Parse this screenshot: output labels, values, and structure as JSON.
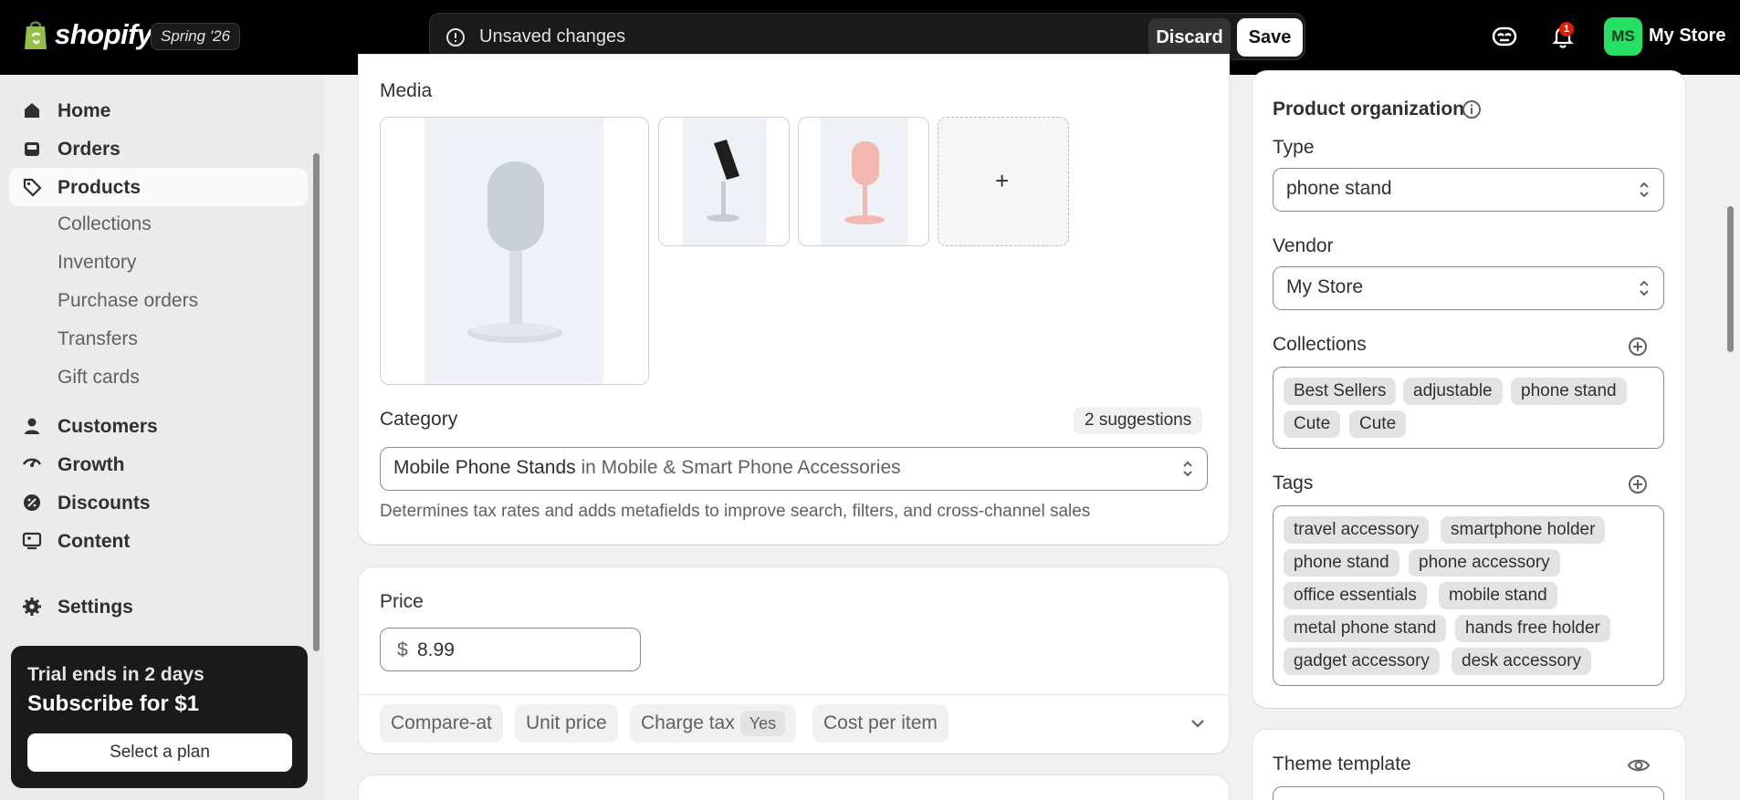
{
  "topbar": {
    "brand": "shopify",
    "edition_badge": "Spring '26",
    "unsaved_text": "Unsaved changes",
    "discard_label": "Discard",
    "save_label": "Save",
    "notification_count": "1",
    "avatar_initials": "MS",
    "store_name": "My Store"
  },
  "sidebar": {
    "items": [
      {
        "label": "Home",
        "icon": "home-icon"
      },
      {
        "label": "Orders",
        "icon": "inbox-icon"
      },
      {
        "label": "Products",
        "icon": "tag-icon"
      },
      {
        "label": "Customers",
        "icon": "person-icon"
      },
      {
        "label": "Growth",
        "icon": "growth-icon"
      },
      {
        "label": "Discounts",
        "icon": "discount-icon"
      },
      {
        "label": "Content",
        "icon": "content-icon"
      },
      {
        "label": "Settings",
        "icon": "gear-icon"
      }
    ],
    "product_subitems": [
      "Collections",
      "Inventory",
      "Purchase orders",
      "Transfers",
      "Gift cards"
    ],
    "trial": {
      "line1": "Trial ends in 2 days",
      "line2": "Subscribe for $1",
      "button": "Select a plan"
    }
  },
  "media": {
    "title": "Media"
  },
  "category": {
    "title": "Category",
    "suggestions": "2 suggestions",
    "value_main": "Mobile Phone Stands",
    "value_rest": " in Mobile & Smart Phone Accessories",
    "help": "Determines tax rates and adds metafields to improve search, filters, and cross-channel sales"
  },
  "price": {
    "title": "Price",
    "currency": "$",
    "value": "8.99",
    "options": {
      "compare_at": "Compare-at",
      "unit_price": "Unit price",
      "charge_tax": "Charge tax",
      "charge_tax_value": "Yes",
      "cost_per_item": "Cost per item"
    }
  },
  "organization": {
    "title": "Product organization",
    "type_label": "Type",
    "type_value": "phone stand",
    "vendor_label": "Vendor",
    "vendor_value": "My Store",
    "collections_label": "Collections",
    "collections": [
      "Best Sellers",
      "adjustable",
      "phone stand",
      "Cute",
      "Cute"
    ],
    "tags_label": "Tags",
    "tags": [
      "travel accessory",
      "smartphone holder",
      "phone stand",
      "phone accessory",
      "office essentials",
      "mobile stand",
      "metal phone stand",
      "hands free holder",
      "gadget accessory",
      "desk accessory"
    ]
  },
  "theme": {
    "title": "Theme template"
  },
  "colors": {
    "topbar": "#000000",
    "avatar": "#25e065",
    "notification": "#e51c00"
  }
}
